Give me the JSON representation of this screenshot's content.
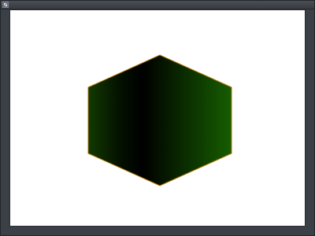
{
  "window": {
    "icon": "app-window-icon"
  },
  "canvas": {
    "background_color": "#ffffff",
    "shape": "hexagon",
    "gradient_colors": [
      "#123a00",
      "#000000",
      "#165d00"
    ],
    "outline_color": "#b27300"
  }
}
